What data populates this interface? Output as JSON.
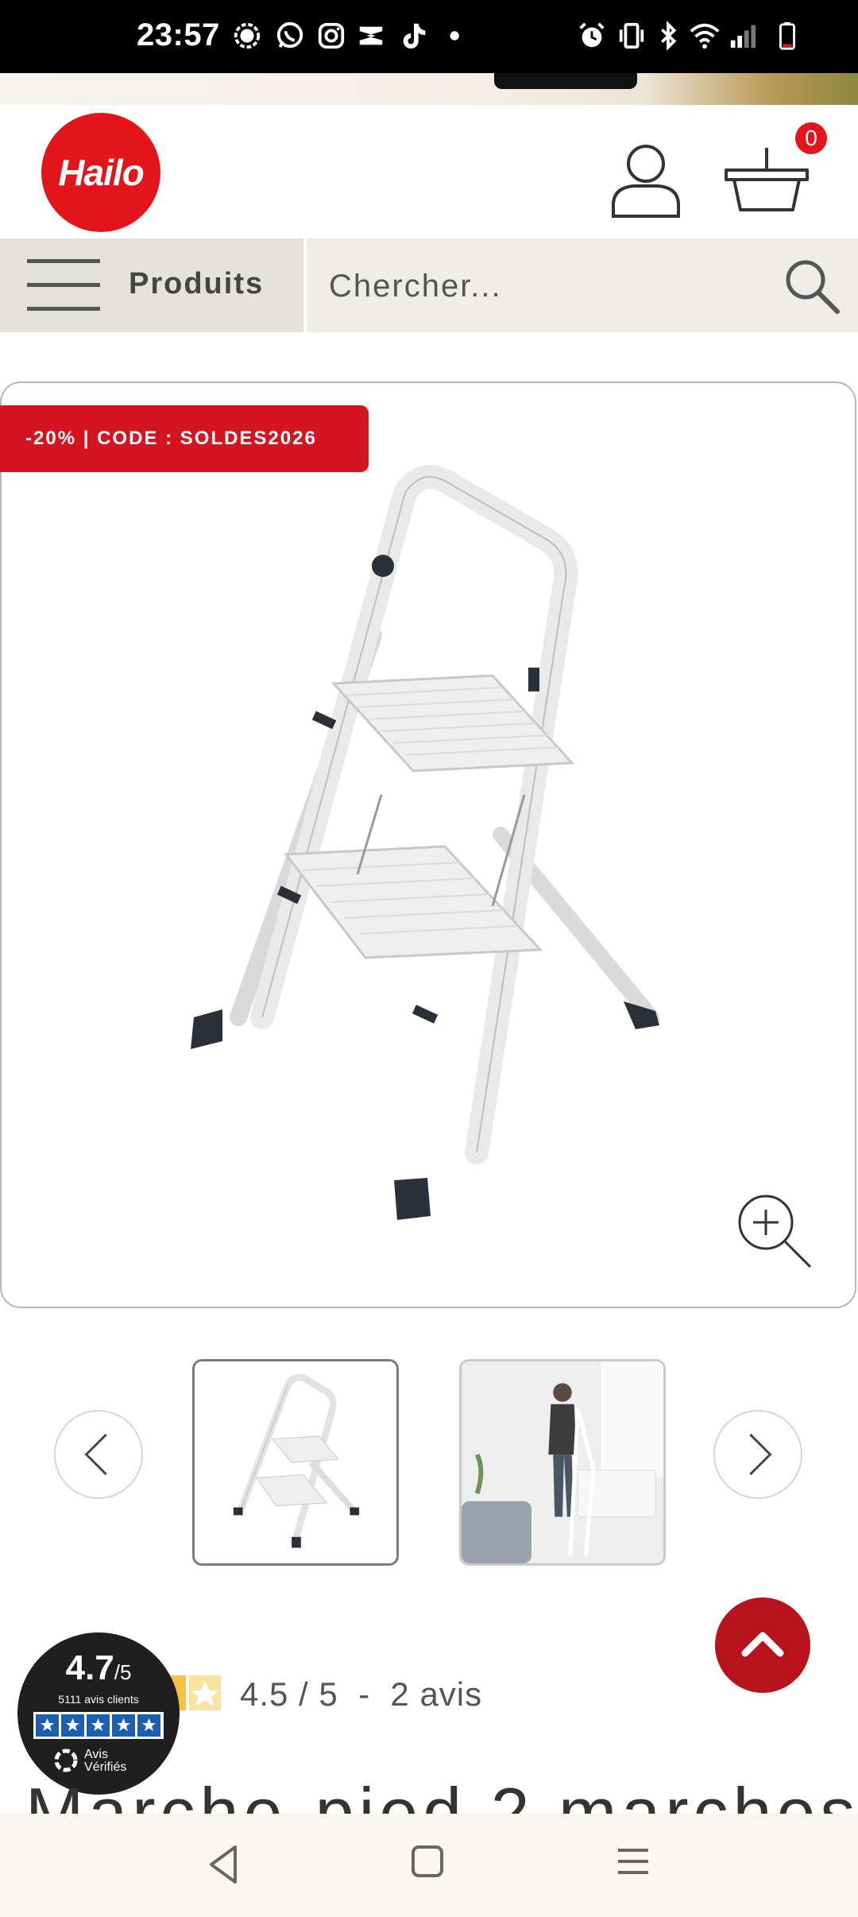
{
  "status_bar": {
    "time": "23:57",
    "icons": [
      "signal-app-icon",
      "whatsapp-icon",
      "instagram-icon",
      "capcut-icon",
      "tiktok-icon",
      "dot-icon",
      "alarm-icon",
      "vibrate-icon",
      "bluetooth-icon",
      "wifi-icon",
      "cellular-signal-icon",
      "battery-icon"
    ]
  },
  "header": {
    "logo_text": "Hailo",
    "cart_count": "0"
  },
  "nav": {
    "products_label": "Produits",
    "search_placeholder": "Chercher..."
  },
  "product": {
    "promo_badge": "-20% | CODE : SOLDES2026",
    "rating_text": "4.5 / 5  -  2 avis",
    "title": "Marche-pied 2 marches"
  },
  "trust_badge": {
    "score": "4.7",
    "score_suffix": "/5",
    "count": "5111 avis clients",
    "brand_line1": "Avis",
    "brand_line2": "Vérifiés"
  },
  "colors": {
    "brand_red": "#e3151a",
    "promo_red": "#d41420",
    "scroll_top_red": "#b8131c",
    "star_yellow": "#f5c242",
    "trust_blue": "#1a5fb4"
  }
}
